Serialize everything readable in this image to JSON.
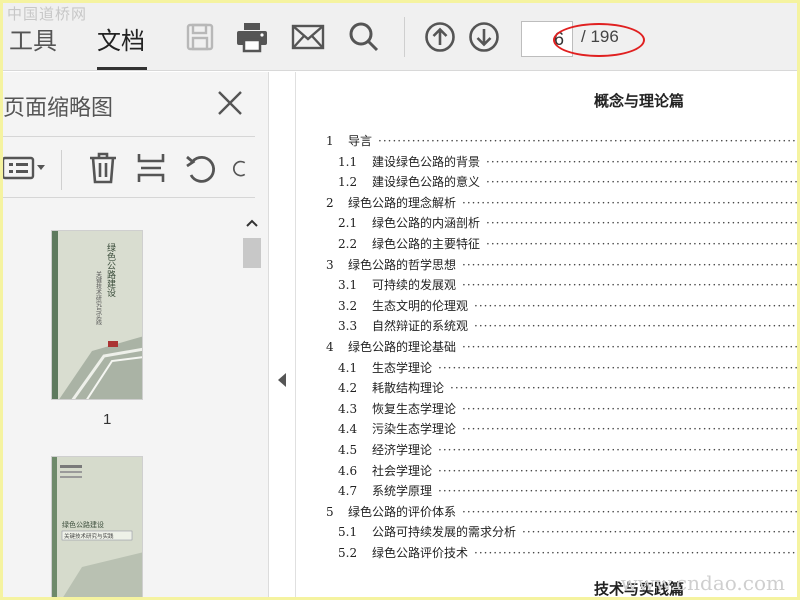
{
  "watermarks": {
    "top": "中国道桥网",
    "bottom": "www.cndao.com"
  },
  "toolbar": {
    "tabs": [
      {
        "label": "工具"
      },
      {
        "label": "文档"
      }
    ],
    "icons": [
      "save-icon",
      "print-icon",
      "email-icon",
      "search-icon",
      "arrow-up-circle-icon",
      "arrow-down-circle-icon"
    ],
    "page_current": "6",
    "page_total": "/ 196"
  },
  "thumb_panel": {
    "title": "页面缩略图",
    "tools": [
      "options-icon",
      "trash-icon",
      "extract-icon",
      "rotate-left-icon",
      "rotate-right-icon"
    ],
    "thumbnails": [
      {
        "label": "1",
        "cover_title": "绿色公路建设",
        "cover_subtitle": "关键技术研究与实践"
      },
      {
        "label": "",
        "cover_title": "绿色公路建设",
        "cover_subtitle": "关键技术研究与实践"
      }
    ]
  },
  "document": {
    "section_title": "概念与理论篇",
    "next_section_title": "技术与实践篇",
    "toc": [
      {
        "level": 1,
        "num": "1",
        "label": "导言"
      },
      {
        "level": 2,
        "num": "1.1",
        "label": "建设绿色公路的背景"
      },
      {
        "level": 2,
        "num": "1.2",
        "label": "建设绿色公路的意义"
      },
      {
        "level": 1,
        "num": "2",
        "label": "绿色公路的理念解析"
      },
      {
        "level": 2,
        "num": "2.1",
        "label": "绿色公路的内涵剖析"
      },
      {
        "level": 2,
        "num": "2.2",
        "label": "绿色公路的主要特征"
      },
      {
        "level": 1,
        "num": "3",
        "label": "绿色公路的哲学思想"
      },
      {
        "level": 2,
        "num": "3.1",
        "label": "可持续的发展观"
      },
      {
        "level": 2,
        "num": "3.2",
        "label": "生态文明的伦理观"
      },
      {
        "level": 2,
        "num": "3.3",
        "label": "自然辩证的系统观"
      },
      {
        "level": 1,
        "num": "4",
        "label": "绿色公路的理论基础"
      },
      {
        "level": 2,
        "num": "4.1",
        "label": "生态学理论"
      },
      {
        "level": 2,
        "num": "4.2",
        "label": "耗散结构理论"
      },
      {
        "level": 2,
        "num": "4.3",
        "label": "恢复生态学理论"
      },
      {
        "level": 2,
        "num": "4.4",
        "label": "污染生态学理论"
      },
      {
        "level": 2,
        "num": "4.5",
        "label": "经济学理论"
      },
      {
        "level": 2,
        "num": "4.6",
        "label": "社会学理论"
      },
      {
        "level": 2,
        "num": "4.7",
        "label": "系统学原理"
      },
      {
        "level": 1,
        "num": "5",
        "label": "绿色公路的评价体系"
      },
      {
        "level": 2,
        "num": "5.1",
        "label": "公路可持续发展的需求分析"
      },
      {
        "level": 2,
        "num": "5.2",
        "label": "绿色公路评价技术"
      }
    ]
  }
}
